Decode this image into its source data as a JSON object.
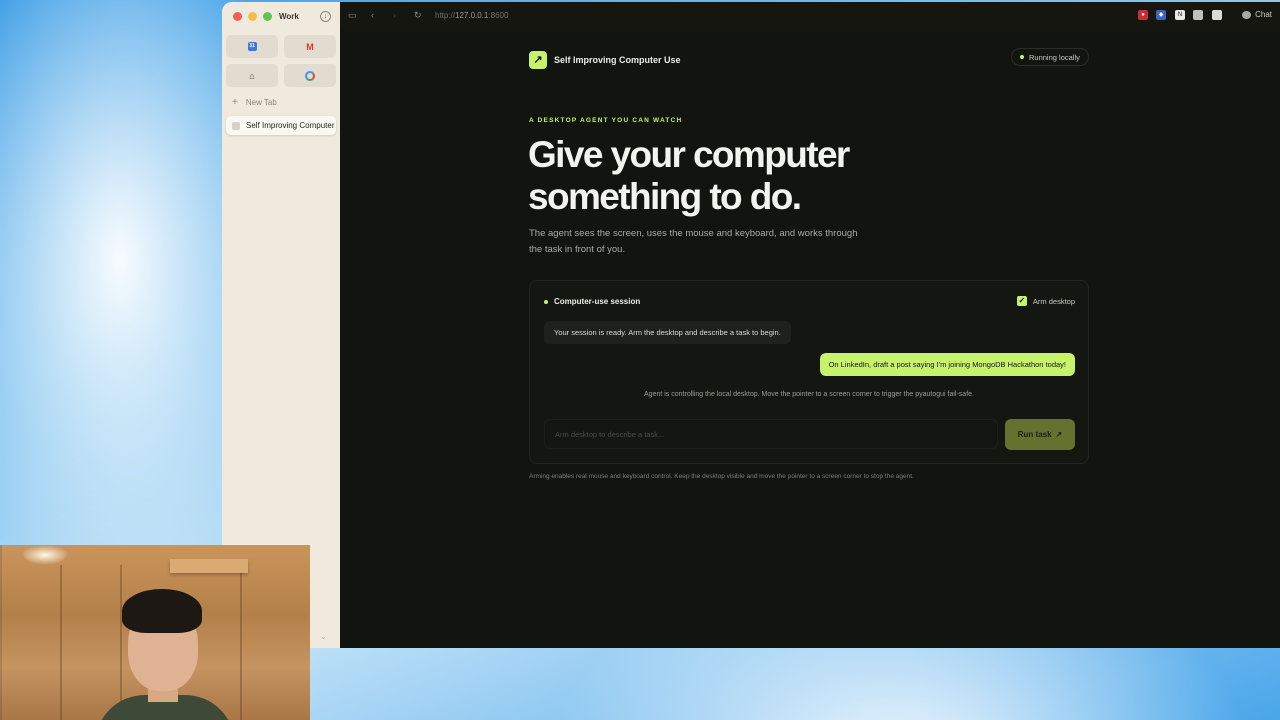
{
  "sidebar": {
    "workspace": "Work",
    "new_tab": "New Tab",
    "active_tab": "Self Improving Computer Use",
    "pins": [
      "calendar-icon",
      "gmail-icon",
      "home-icon",
      "google-icon"
    ]
  },
  "toolbar": {
    "url_prefix": "http://",
    "url_host": "127.0.0.1",
    "url_port": ":8600",
    "chat_label": "Chat"
  },
  "page": {
    "brand_name": "Self Improving Computer Use",
    "status": "Running locally",
    "eyebrow": "A DESKTOP AGENT YOU CAN WATCH",
    "hero_line1": "Give your computer",
    "hero_line2": "something to do.",
    "hero_sub": "The agent sees the screen, uses the mouse and keyboard, and works through the task in front of you.",
    "footnote": "Arming enables real mouse and keyboard control. Keep the desktop visible and move the pointer to a screen corner to stop the agent."
  },
  "session": {
    "title": "Computer-use session",
    "arm_label": "Arm desktop",
    "arm_checked": true,
    "agent_message": "Your session is ready. Arm the desktop and describe a task to begin.",
    "user_message": "On LinkedIn, draft a post saying I'm joining MongoDB Hackathon today!",
    "system_note": "Agent is controlling the local desktop. Move the pointer to a screen corner to trigger the pyautogui fail-safe.",
    "input_placeholder": "Arm desktop to describe a task...",
    "input_value": "",
    "run_label": "Run task"
  },
  "colors": {
    "accent": "#c7f36a",
    "page_bg": "#121410",
    "run_button": "#65712f"
  }
}
